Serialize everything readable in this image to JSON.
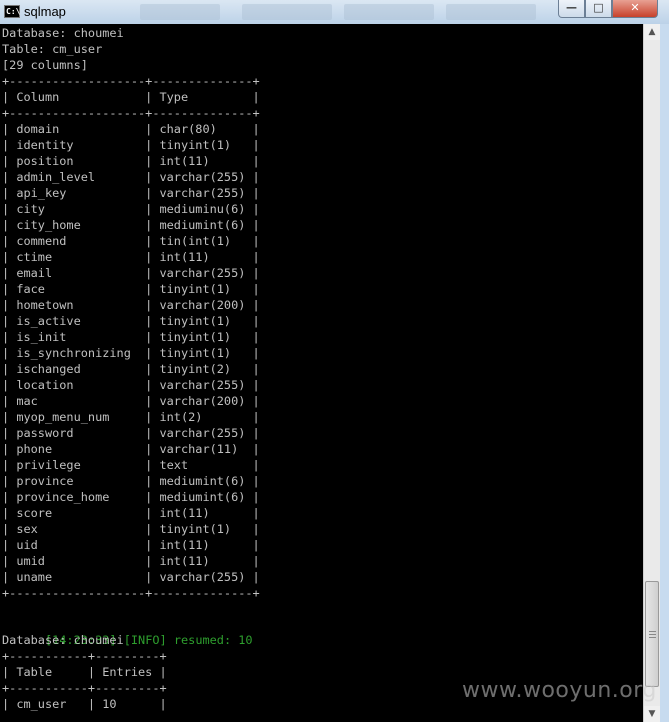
{
  "window": {
    "title": "sqlmap",
    "icon_text": "C:\\",
    "buttons": {
      "minimize": "—",
      "maximize": "□",
      "close": "✕"
    }
  },
  "console_lines": [
    "Database: choumei",
    "Table: cm_user",
    "[29 columns]",
    "+-------------------+--------------+",
    "| Column            | Type         |",
    "+-------------------+--------------+",
    "| domain            | char(80)     |",
    "| identity          | tinyint(1)   |",
    "| position          | int(11)      |",
    "| admin_level       | varchar(255) |",
    "| api_key           | varchar(255) |",
    "| city              | mediuminu(6) |",
    "| city_home         | mediumint(6) |",
    "| commend           | tin(int(1)   |",
    "| ctime             | int(11)      |",
    "| email             | varchar(255) |",
    "| face              | tinyint(1)   |",
    "| hometown          | varchar(200) |",
    "| is_active         | tinyint(1)   |",
    "| is_init           | tinyint(1)   |",
    "| is_synchronizing  | tinyint(1)   |",
    "| ischanged         | tinyint(2)   |",
    "| location          | varchar(255) |",
    "| mac               | varchar(200) |",
    "| myop_menu_num     | int(2)       |",
    "| password          | varchar(255) |",
    "| phone             | varchar(11)  |",
    "| privilege         | text         |",
    "| province          | mediumint(6) |",
    "| province_home     | mediumint(6) |",
    "| score             | int(11)      |",
    "| sex               | tinyint(1)   |",
    "| uid               | int(11)      |",
    "| umid              | int(11)      |",
    "| uname             | varchar(255) |",
    "+-------------------+--------------+",
    "",
    "",
    "",
    "Database: choumei",
    "",
    "| Table     | Entries |",
    "+-----------+---------+",
    "| cm_user   | 10      |"
  ],
  "table_border_top_2": "+-----------+---------+",
  "info_line": {
    "time": "[14:23:33]",
    "tag": "[INFO]",
    "message": "resumed: 10"
  },
  "scrollbar": {
    "up_arrow": "▲",
    "down_arrow": "▼"
  },
  "watermark": "www.wooyun.org"
}
